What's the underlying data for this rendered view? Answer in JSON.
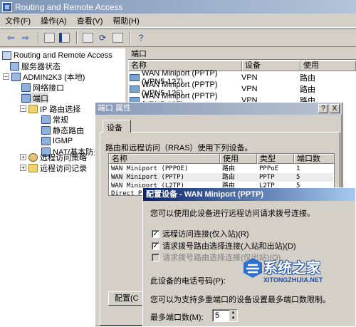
{
  "window": {
    "title": "Routing and Remote Access"
  },
  "menu": [
    "文件(F)",
    "操作(A)",
    "查看(V)",
    "帮助(H)"
  ],
  "tree": {
    "root": "Routing and Remote Access",
    "server_status": "服务器状态",
    "server": "ADMIN2K3 (本地)",
    "network_interfaces": "网络接口",
    "ports": "端口",
    "ip_routing": "IP 路由选择",
    "general": "常规",
    "static_routes": "静态路由",
    "igmp": "IGMP",
    "nat": "NAT/基本防火墙",
    "remote_access_policy": "远程访问策略",
    "remote_access_log": "远程访问记录"
  },
  "right_pane": {
    "header": "端口",
    "columns": [
      "名称",
      "设备",
      "使用"
    ],
    "rows": [
      {
        "name": "WAN Miniport (PPTP) (VPN5-127)",
        "device": "VPN",
        "use": "路由"
      },
      {
        "name": "WAN Miniport (PPTP) (VPN5-126)",
        "device": "VPN",
        "use": "路由"
      },
      {
        "name": "WAN Miniport (PPTP) (VPN5-125)",
        "device": "VPN",
        "use": "路由"
      }
    ]
  },
  "ports_dialog": {
    "title": "端口 属性",
    "help_btn": "?",
    "close_btn": "X",
    "tab": "设备",
    "description": "路由和远程访问（RRAS）使用下列设备。",
    "columns": [
      "名称",
      "使用",
      "类型",
      "端口数"
    ],
    "rows": [
      {
        "name": "WAN Miniport (PPPOE)",
        "use": "路由",
        "type": "PPPoE",
        "ports": "1"
      },
      {
        "name": "WAN Miniport (PPTP)",
        "use": "路由",
        "type": "PPTP",
        "ports": "5"
      },
      {
        "name": "WAN Miniport (L2TP)",
        "use": "路由",
        "type": "L2TP",
        "ports": "5"
      },
      {
        "name": "Direct P",
        "use": "",
        "type": "",
        "ports": ""
      }
    ],
    "configure_btn": "配置(C"
  },
  "config_dialog": {
    "title": "配置设备 - WAN Miniport (PPTP)",
    "intro": "您可以使用此设备进行远程访问请求拨号连接。",
    "options": [
      {
        "label": "远程访问连接(仅入站)(R)",
        "checked": "✓"
      },
      {
        "label": "请求拨号路由选择连接(入站和出站)(D)",
        "checked": "✓"
      },
      {
        "label": "请求拨号路由选择连接(仅出站)(O)",
        "checked": ""
      }
    ],
    "phone_label": "此设备的电话号码(P):",
    "multi_port_text": "您可以为支持多重端口的设备设置最多端口数限制。",
    "max_ports_label": "最多端口数(M):",
    "max_ports_value": "5"
  },
  "watermark": {
    "main": "系统之家",
    "sub": "XITONGZHIJIA.NET"
  }
}
